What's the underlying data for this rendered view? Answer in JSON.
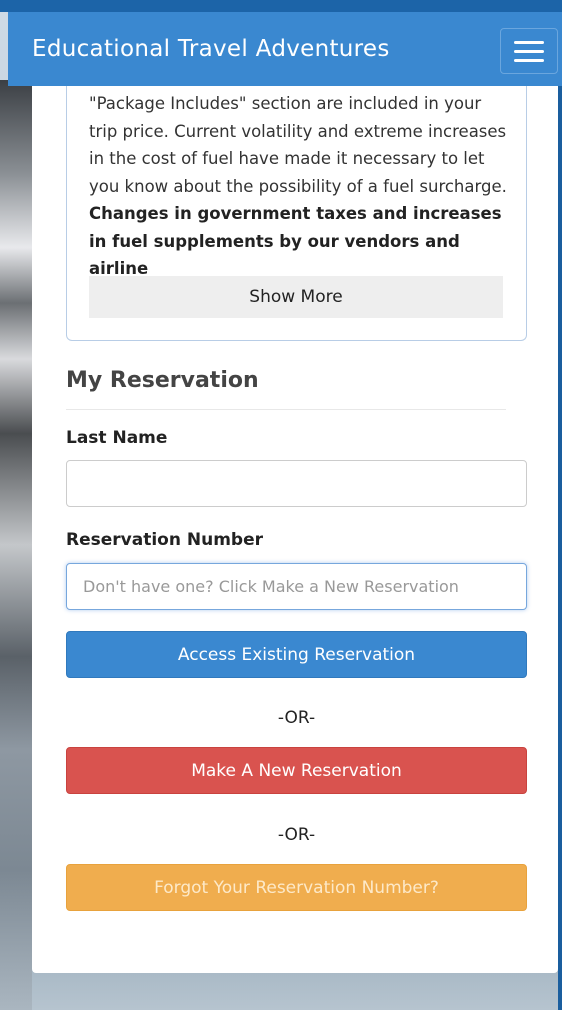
{
  "navbar": {
    "brand": "Educational Travel Adventures",
    "menu_icon": "hamburger-menu-icon"
  },
  "info": {
    "text_normal": "\"Package Includes\" section are included in your trip price. Current volatility and extreme increases in the cost of fuel have made it necessary to let you know about the possibility of a fuel surcharge. ",
    "text_bold": "Changes in government taxes and increases in fuel supplements by our vendors and airline",
    "show_more_label": "Show More"
  },
  "reservation": {
    "title": "My Reservation",
    "last_name_label": "Last Name",
    "last_name_value": "",
    "reservation_number_label": "Reservation Number",
    "reservation_number_placeholder": "Don't have one? Click Make a New Reservation",
    "access_button": "Access Existing Reservation",
    "or_1": "-OR-",
    "new_button": "Make A New Reservation",
    "or_2": "-OR-",
    "forgot_button": "Forgot Your Reservation Number?"
  },
  "colors": {
    "navbar": "#3a88d0",
    "primary": "#3a88d0",
    "danger": "#d9534f",
    "warning": "#f0ad4e"
  }
}
